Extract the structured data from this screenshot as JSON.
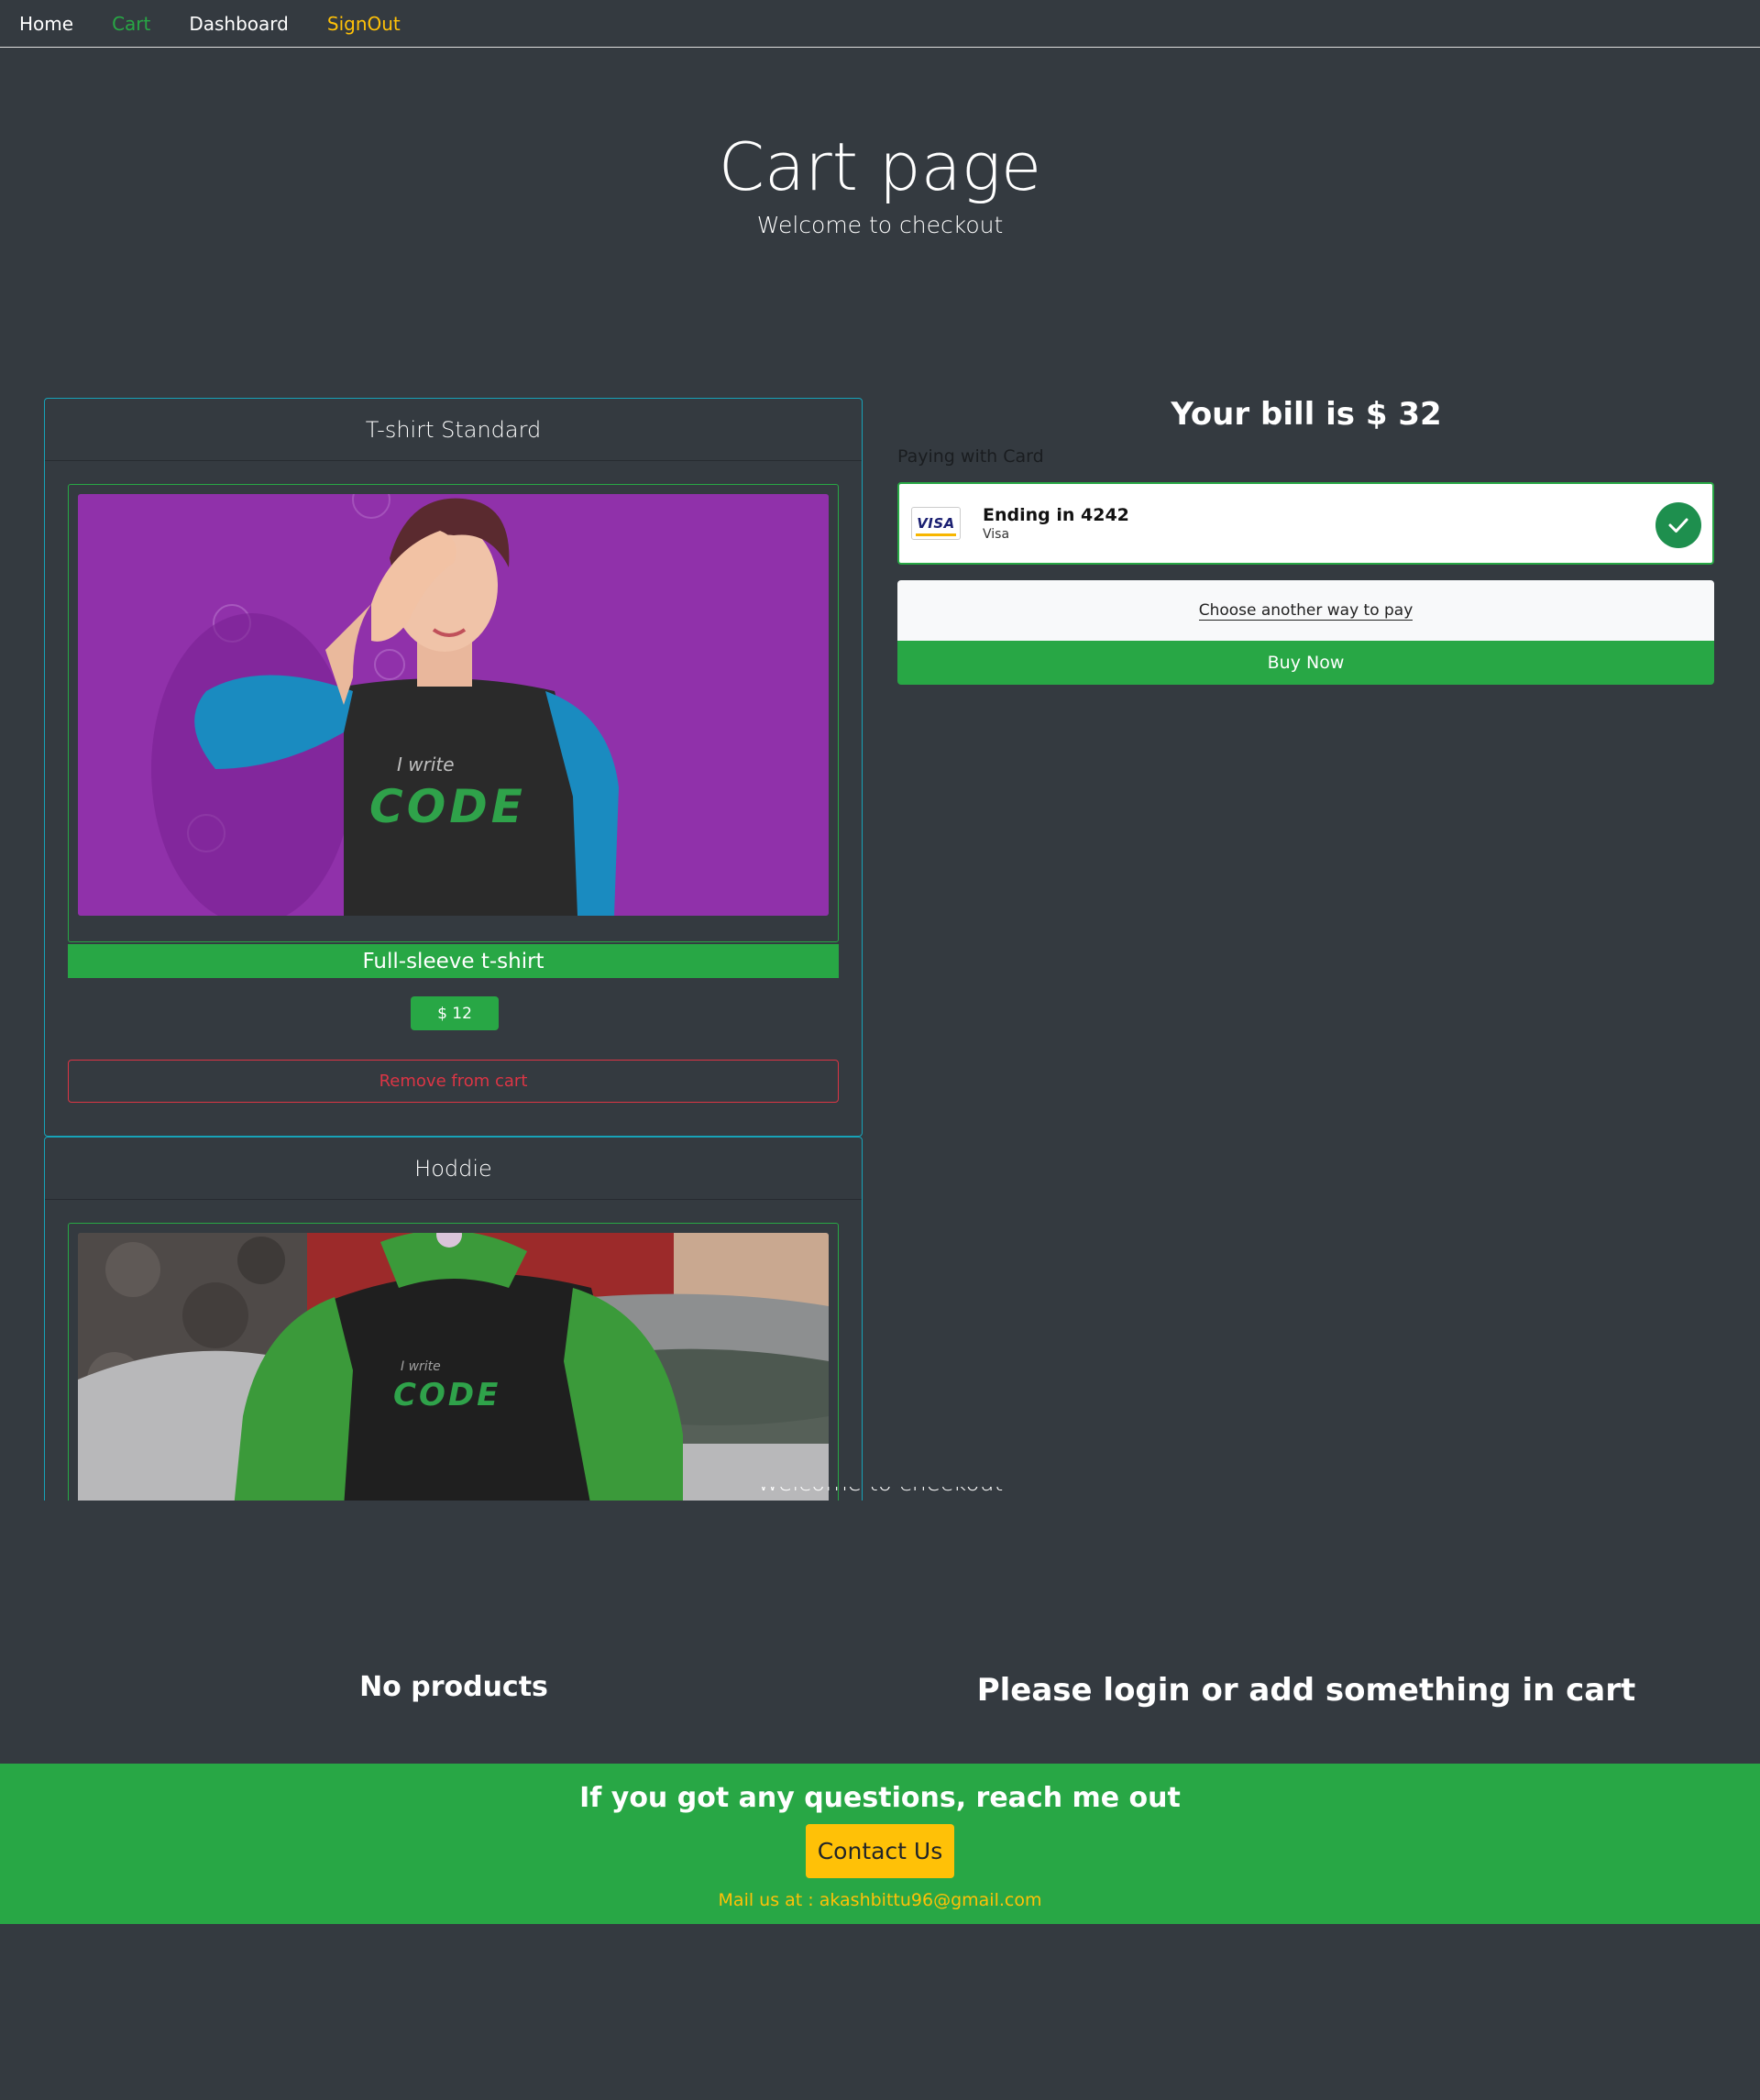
{
  "nav": {
    "home": "Home",
    "cart": "Cart",
    "dashboard": "Dashboard",
    "signout": "SignOut"
  },
  "hero": {
    "title": "Cart page",
    "subtitle": "Welcome to checkout"
  },
  "products": [
    {
      "header": "T-shirt Standard",
      "name": "Full-sleeve t-shirt",
      "price": "$ 12",
      "remove_label": "Remove from cart",
      "image": {
        "print_small": "I write",
        "print_big": "CODE"
      }
    },
    {
      "header": "Hoddie",
      "image": {
        "print_small": "I write",
        "print_big": "CODE"
      }
    }
  ],
  "checkout": {
    "bill": "Your bill is $ 32",
    "paying_label": "Paying with Card",
    "card_ending": "Ending in 4242",
    "card_brand": "Visa",
    "card_logo_text": "VISA",
    "other_pay": "Choose another way to pay",
    "buy_now": "Buy Now"
  },
  "overlay": {
    "subtitle": "Welcome to checkout",
    "no_products": "No products",
    "login_msg": "Please login or add something in cart"
  },
  "footer": {
    "title": "If you got any questions, reach me out",
    "contact_button": "Contact Us",
    "mail": "Mail us at : akashbittu96@gmail.com"
  },
  "colors": {
    "background": "#343a40",
    "success": "#28a745",
    "warning": "#ffc107",
    "danger": "#dc3545",
    "info": "#17a2b8"
  }
}
